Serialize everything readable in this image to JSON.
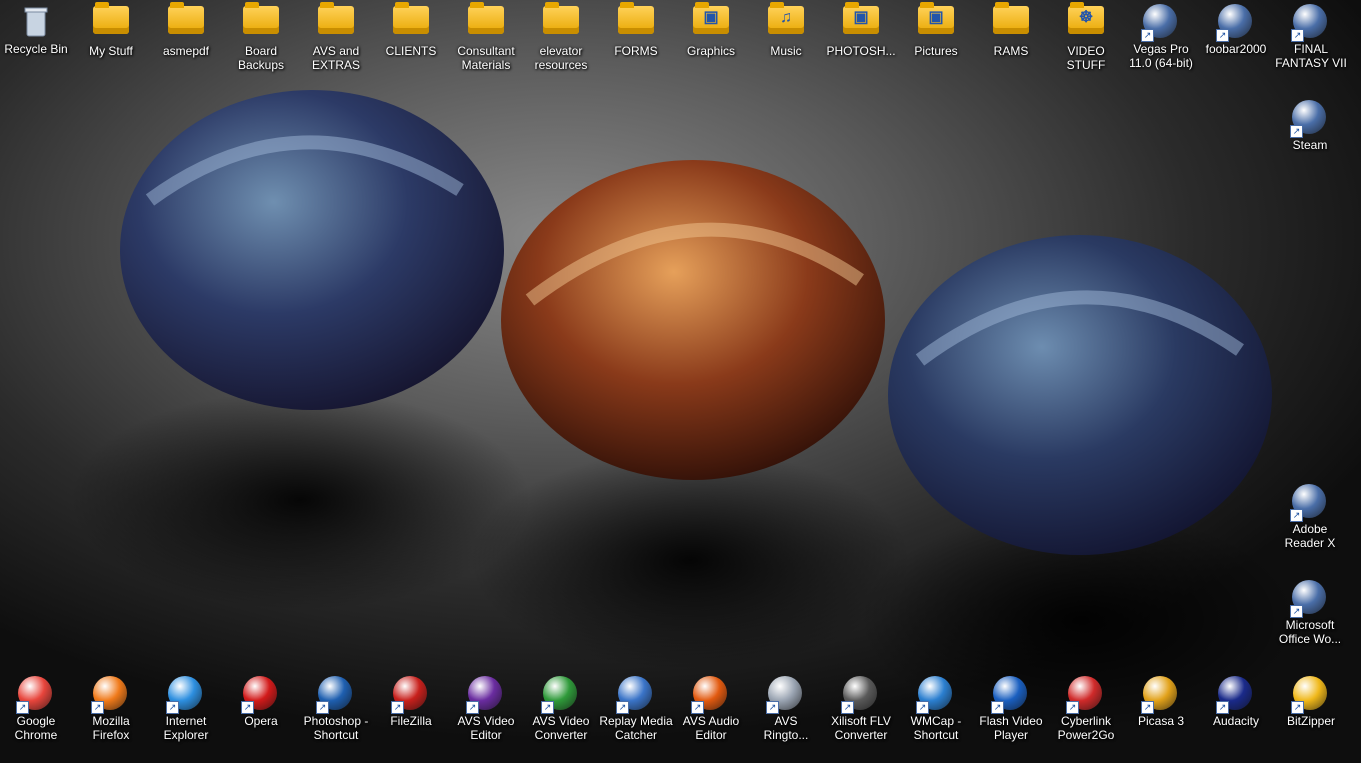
{
  "top_row": [
    {
      "label": "Recycle Bin",
      "icon": "recycle-bin-icon"
    },
    {
      "label": "My Stuff",
      "icon": "folder-icon"
    },
    {
      "label": "asmepdf",
      "icon": "folder-icon"
    },
    {
      "label": "Board\nBackups",
      "icon": "folder-icon"
    },
    {
      "label": "AVS and\nEXTRAS",
      "icon": "folder-icon"
    },
    {
      "label": "CLIENTS",
      "icon": "folder-icon"
    },
    {
      "label": "Consultant\nMaterials",
      "icon": "folder-icon"
    },
    {
      "label": "elevator\nresources",
      "icon": "folder-icon"
    },
    {
      "label": "FORMS",
      "icon": "folder-icon"
    },
    {
      "label": "Graphics",
      "icon": "folder-camera-icon"
    },
    {
      "label": "Music",
      "icon": "folder-music-icon"
    },
    {
      "label": "PHOTOSH...",
      "icon": "folder-camera-icon"
    },
    {
      "label": "Pictures",
      "icon": "folder-camera-icon"
    },
    {
      "label": "RAMS",
      "icon": "folder-icon"
    },
    {
      "label": "VIDEO STUFF",
      "icon": "folder-film-icon"
    },
    {
      "label": "Vegas Pro\n11.0 (64-bit)",
      "icon": "vegas-pro-icon"
    },
    {
      "label": "foobar2000",
      "icon": "foobar-icon"
    },
    {
      "label": "FINAL\nFANTASY VII",
      "icon": "final-fantasy-icon"
    }
  ],
  "right_column": [
    {
      "label": "Steam",
      "icon": "steam-icon"
    },
    {
      "label": "Adobe\nReader X",
      "icon": "adobe-reader-icon"
    },
    {
      "label": "Microsoft\nOffice Wo...",
      "icon": "word-icon"
    }
  ],
  "bottom_row": [
    {
      "label": "Google\nChrome",
      "icon": "chrome-icon",
      "color": "#e8453c"
    },
    {
      "label": "Mozilla\nFirefox",
      "icon": "firefox-icon",
      "color": "#f07a1a"
    },
    {
      "label": "Internet\nExplorer",
      "icon": "ie-icon",
      "color": "#2d8fe0"
    },
    {
      "label": "Opera",
      "icon": "opera-icon",
      "color": "#d21a1a"
    },
    {
      "label": "Photoshop -\nShortcut",
      "icon": "photoshop-icon",
      "color": "#1e5fb0"
    },
    {
      "label": "FileZilla",
      "icon": "filezilla-icon",
      "color": "#c8201c"
    },
    {
      "label": "AVS Video\nEditor",
      "icon": "avs-video-editor-icon",
      "color": "#6a2ca0"
    },
    {
      "label": "AVS Video\nConverter",
      "icon": "avs-video-converter-icon",
      "color": "#2f9a3a"
    },
    {
      "label": "Replay Media\nCatcher",
      "icon": "replay-media-icon",
      "color": "#3a74c8"
    },
    {
      "label": "AVS Audio\nEditor",
      "icon": "avs-audio-editor-icon",
      "color": "#e25a10"
    },
    {
      "label": "AVS\nRingto...",
      "icon": "avs-ringtone-icon",
      "color": "#9aa4b2"
    },
    {
      "label": "Xilisoft FLV\nConverter",
      "icon": "film-reel-icon",
      "color": "#5a5a5a"
    },
    {
      "label": "WMCap -\nShortcut",
      "icon": "wmcap-icon",
      "color": "#2b7fd0"
    },
    {
      "label": "Flash Video\nPlayer",
      "icon": "flv-player-icon",
      "color": "#1a5fc0"
    },
    {
      "label": "Cyberlink\nPower2Go",
      "icon": "power2go-icon",
      "color": "#d02a2a"
    },
    {
      "label": "Picasa 3",
      "icon": "picasa-icon",
      "color": "#e2a21a"
    },
    {
      "label": "Audacity",
      "icon": "audacity-icon",
      "color": "#1a2a8a"
    },
    {
      "label": "BitZipper",
      "icon": "bitzipper-icon",
      "color": "#f0b81a"
    }
  ]
}
